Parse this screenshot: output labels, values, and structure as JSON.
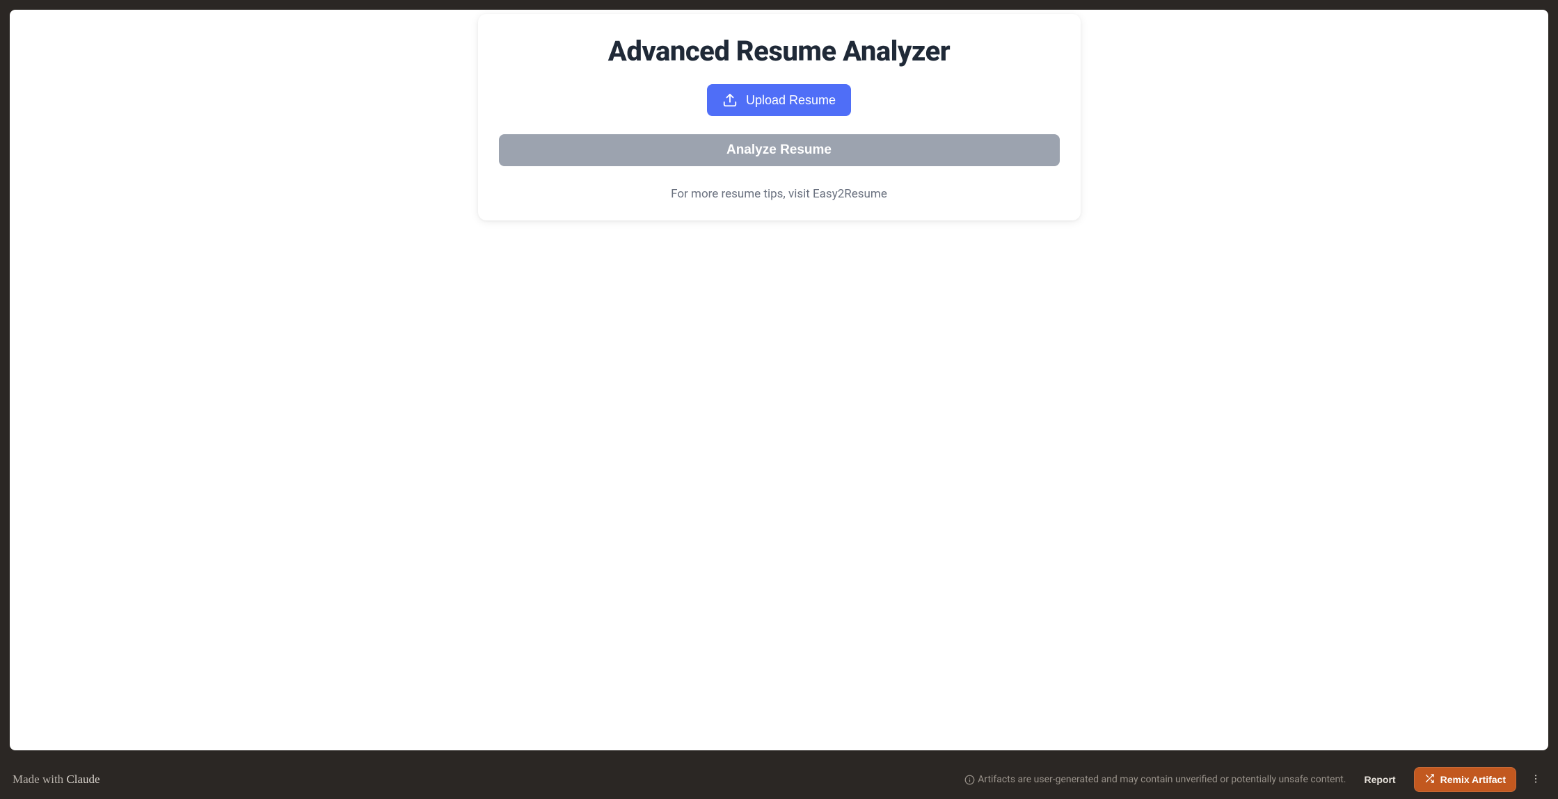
{
  "main": {
    "title": "Advanced Resume Analyzer",
    "upload_label": "Upload Resume",
    "analyze_label": "Analyze Resume",
    "tips_prefix": "For more resume tips, visit ",
    "tips_link_text": "Easy2Resume"
  },
  "footer": {
    "made_with_prefix": "Made with ",
    "made_with_brand": "Claude",
    "disclaimer": "Artifacts are user-generated and may contain unverified or potentially unsafe content.",
    "report_label": "Report",
    "remix_label": "Remix Artifact"
  },
  "colors": {
    "primary_button": "#4f6ef7",
    "disabled_button": "#9ca3af",
    "heading": "#1f2937",
    "muted_text": "#6b7280",
    "remix_button": "#c2581f",
    "frame_bg": "#2b2724"
  }
}
